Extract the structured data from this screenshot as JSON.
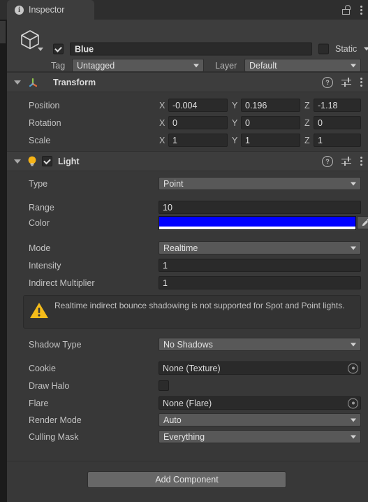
{
  "window": {
    "tab_label": "Inspector",
    "tab_icon": "info-icon",
    "lock_icon": "unlocked-padlock-icon",
    "menu_icon": "kebab-menu-icon"
  },
  "gameobject": {
    "icon": "cube-gameobject-icon",
    "enabled": true,
    "name": "Blue",
    "static_checked": false,
    "static_label": "Static",
    "tag_label": "Tag",
    "tag_value": "Untagged",
    "layer_label": "Layer",
    "layer_value": "Default"
  },
  "transform": {
    "title": "Transform",
    "icon": "transform-gizmo-icon",
    "help_icon": "help-icon",
    "preset_icon": "preset-settings-icon",
    "menu_icon": "kebab-menu-icon",
    "axes": [
      "X",
      "Y",
      "Z"
    ],
    "rows": [
      {
        "label": "Position",
        "x": "-0.004",
        "y": "0.196",
        "z": "-1.18"
      },
      {
        "label": "Rotation",
        "x": "0",
        "y": "0",
        "z": "0"
      },
      {
        "label": "Scale",
        "x": "1",
        "y": "1",
        "z": "1"
      }
    ]
  },
  "light": {
    "title": "Light",
    "icon": "lightbulb-icon",
    "enabled": true,
    "help_icon": "help-icon",
    "preset_icon": "preset-settings-icon",
    "menu_icon": "kebab-menu-icon",
    "type_label": "Type",
    "type_value": "Point",
    "range_label": "Range",
    "range_value": "10",
    "color_label": "Color",
    "color_value": "#0000FF",
    "color_alpha": "#FFFFFF",
    "eyedropper_icon": "eyedropper-icon",
    "mode_label": "Mode",
    "mode_value": "Realtime",
    "intensity_label": "Intensity",
    "intensity_value": "1",
    "indirect_label": "Indirect Multiplier",
    "indirect_value": "1",
    "warning_icon": "warning-triangle-icon",
    "warning_text": "Realtime indirect bounce shadowing is not supported for Spot and Point lights.",
    "shadow_type_label": "Shadow Type",
    "shadow_type_value": "No Shadows",
    "cookie_label": "Cookie",
    "cookie_value": "None (Texture)",
    "cookie_picker_icon": "object-picker-icon",
    "draw_halo_label": "Draw Halo",
    "draw_halo_checked": false,
    "flare_label": "Flare",
    "flare_value": "None (Flare)",
    "flare_picker_icon": "object-picker-icon",
    "render_mode_label": "Render Mode",
    "render_mode_value": "Auto",
    "culling_mask_label": "Culling Mask",
    "culling_mask_value": "Everything"
  },
  "footer": {
    "add_component_label": "Add Component"
  },
  "theme": {
    "panel_bg": "#383838",
    "header_bg": "#3d3d3d",
    "field_bg": "#2a2a2a",
    "popup_bg": "#585858",
    "text": "#c2c2c2",
    "warning_yellow": "#FFC107",
    "light_color": "#0000FF"
  }
}
